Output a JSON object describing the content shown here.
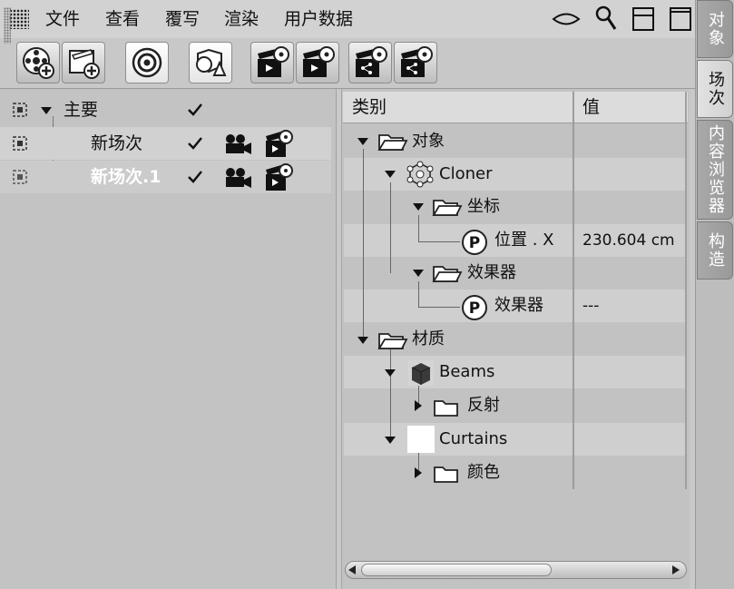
{
  "menu": {
    "items": [
      "文件",
      "查看",
      "覆写",
      "渲染",
      "用户数据"
    ]
  },
  "window_icons": [
    "view-eye-icon",
    "search-icon",
    "split-layout-icon",
    "maximize-icon"
  ],
  "toolbar": {
    "buttons": [
      "add-scene-icon",
      "add-take-icon",
      "auto-take-icon",
      "override-objects-icon",
      "render-take-icon",
      "render-all-takes-icon",
      "share-take-icon",
      "share-all-takes-icon"
    ]
  },
  "side_tabs": [
    "对象",
    "场次",
    "内容浏览器",
    "构造"
  ],
  "side_tab_active": "场次",
  "scenes": [
    {
      "name": "主要",
      "checked": true,
      "has_camera": false
    },
    {
      "name": "新场次",
      "checked": true,
      "has_camera": true
    },
    {
      "name": "新场次.1",
      "checked": true,
      "has_camera": true
    }
  ],
  "tree_header": {
    "category": "类别",
    "value": "值"
  },
  "tree": [
    {
      "label": "对象",
      "value": ""
    },
    {
      "label": "Cloner",
      "value": ""
    },
    {
      "label": "坐标",
      "value": ""
    },
    {
      "label": "位置 . X",
      "value": "230.604 cm"
    },
    {
      "label": "效果器",
      "value": ""
    },
    {
      "label": "效果器",
      "value": "---"
    },
    {
      "label": "材质",
      "value": ""
    },
    {
      "label": "Beams",
      "value": ""
    },
    {
      "label": "反射",
      "value": ""
    },
    {
      "label": "Curtains",
      "value": ""
    },
    {
      "label": "颜色",
      "value": ""
    }
  ]
}
